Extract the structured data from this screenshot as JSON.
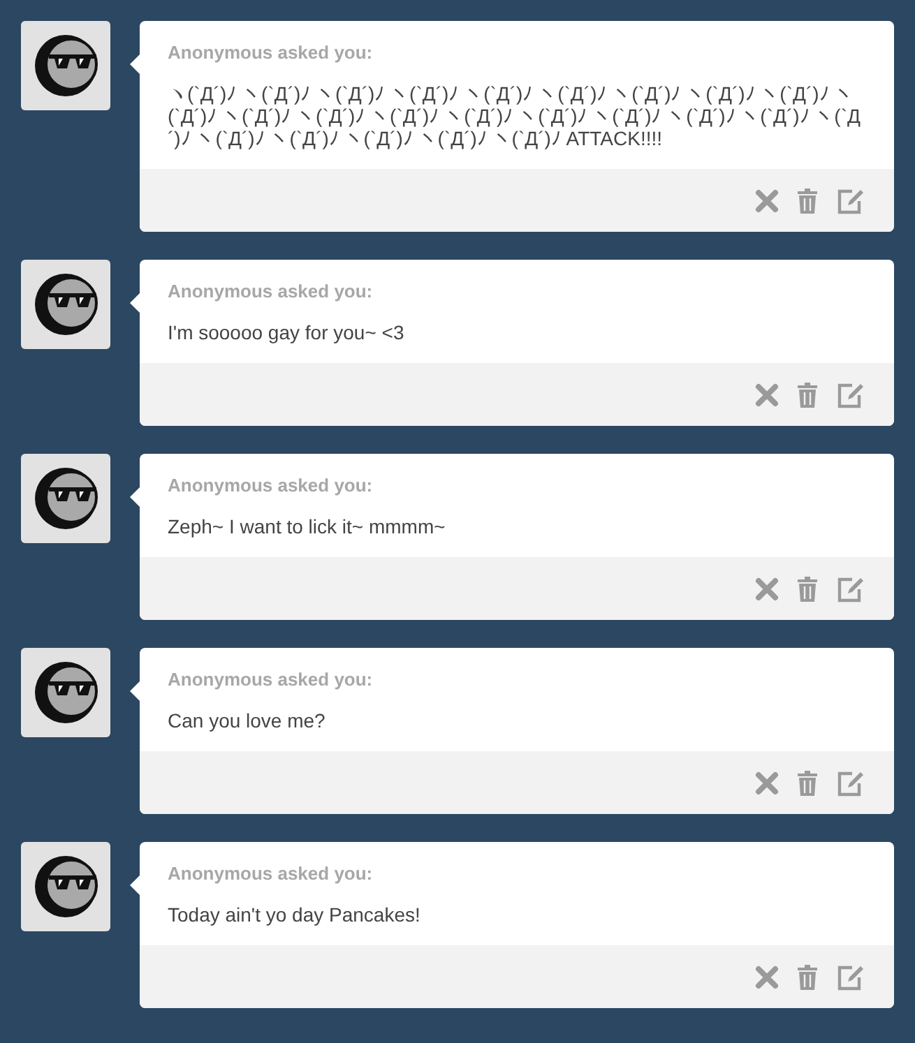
{
  "asks": [
    {
      "asker": "Anonymous asked you:",
      "question": "ヽ(`Д´)ﾉ ヽ(`Д´)ﾉ ヽ(`Д´)ﾉ ヽ(`Д´)ﾉ ヽ(`Д´)ﾉ ヽ(`Д´)ﾉ ヽ(`Д´)ﾉ ヽ(`Д´)ﾉ ヽ(`Д´)ﾉ ヽ(`Д´)ﾉ ヽ(`Д´)ﾉ ヽ(`Д´)ﾉ ヽ(`Д´)ﾉ ヽ(`Д´)ﾉ ヽ(`Д´)ﾉ ヽ(`Д´)ﾉ ヽ(`Д´)ﾉ ヽ(`Д´)ﾉ ヽ(`Д´)ﾉ ヽ(`Д´)ﾉ ヽ(`Д´)ﾉ ヽ(`Д´)ﾉ ヽ(`Д´)ﾉ ヽ(`Д´)ﾉ ATTACK!!!!"
    },
    {
      "asker": "Anonymous asked you:",
      "question": "I'm sooooo gay for you~ <3"
    },
    {
      "asker": "Anonymous asked you:",
      "question": "Zeph~ I want to lick it~ mmmm~"
    },
    {
      "asker": "Anonymous asked you:",
      "question": "Can you love me?"
    },
    {
      "asker": "Anonymous asked you:",
      "question": "Today ain't yo day Pancakes!"
    }
  ]
}
